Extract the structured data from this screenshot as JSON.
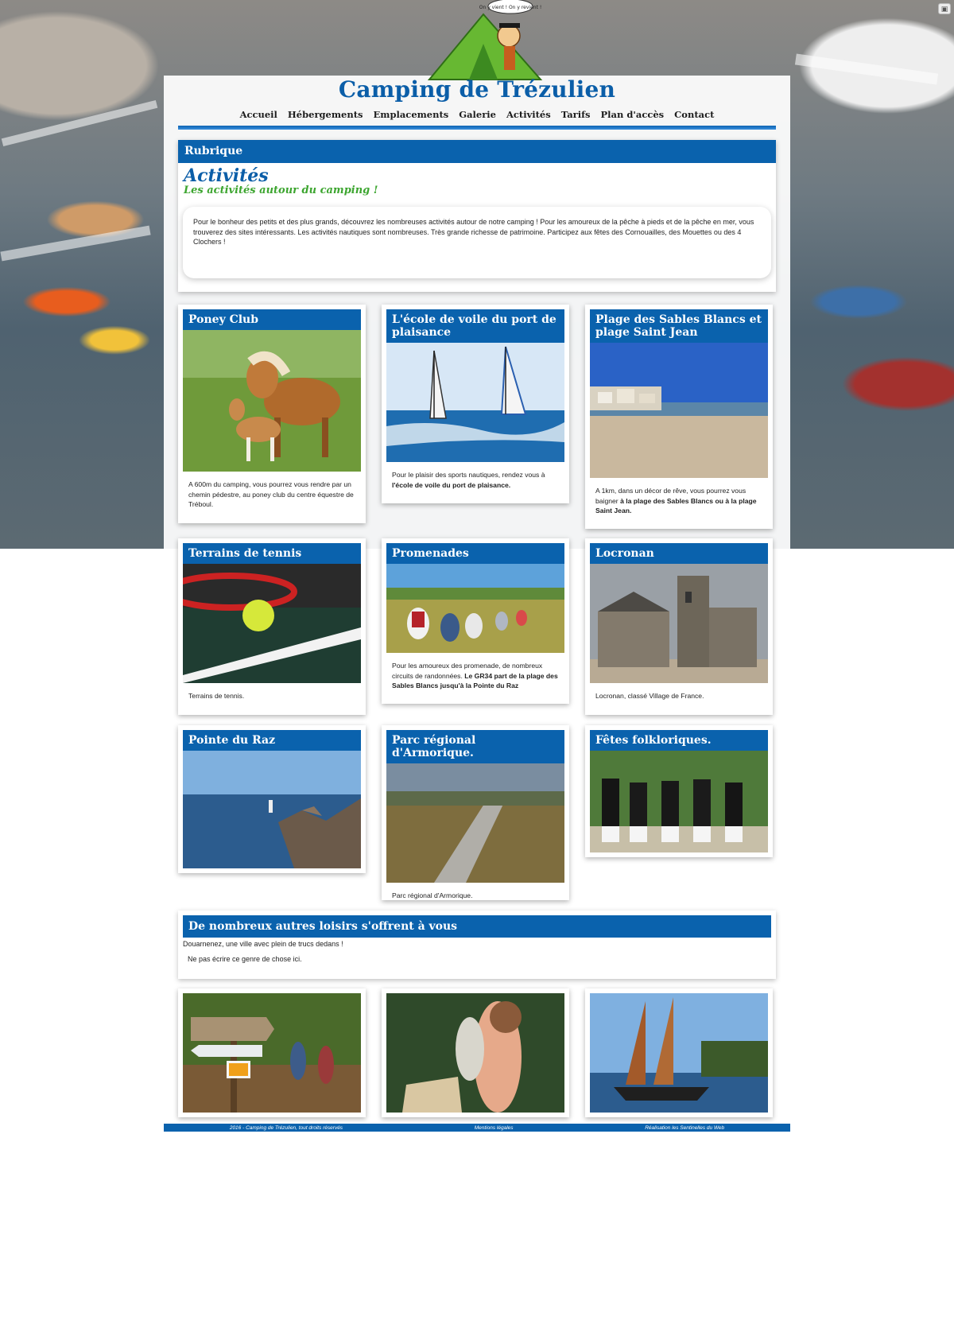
{
  "site": {
    "title": "Camping de Trézulien",
    "logo_bubble": "On y vient ! On y revient !"
  },
  "nav": [
    {
      "label": "Accueil"
    },
    {
      "label": "Hébergements"
    },
    {
      "label": "Emplacements"
    },
    {
      "label": "Galerie"
    },
    {
      "label": "Activités"
    },
    {
      "label": "Tarifs"
    },
    {
      "label": "Plan d'accès"
    },
    {
      "label": "Contact"
    }
  ],
  "rubrique": {
    "label": "Rubrique",
    "title": "Activités",
    "subtitle": "Les activités autour du camping !",
    "intro": "Pour le bonheur des petits et des plus grands, découvrez les nombreuses activités autour de notre camping ! Pour les amoureux de la pêche à pieds et de la pêche en mer, vous trouverez des sites intéressants. Les activités nautiques sont nombreuses. Très grande richesse de patrimoine. Participez aux fêtes des Cornouailles, des Mouettes ou des 4 Clochers !"
  },
  "cards": [
    {
      "title": "Poney Club",
      "text_a": "A 600m du camping, vous pourrez vous rendre par un chemin pédestre, au poney club du centre équestre de Tréboul.",
      "text_b": ""
    },
    {
      "title": "L'école de voile du port de plaisance",
      "text_a": "Pour le plaisir des sports nautiques, rendez vous à ",
      "text_b": "l'école de voile du port de plaisance."
    },
    {
      "title": "Plage des Sables Blancs et plage Saint Jean",
      "text_a": "A 1km, dans un décor de rêve, vous pourrez vous baigner ",
      "text_b": "à la plage des Sables Blancs ou à la plage Saint Jean."
    },
    {
      "title": "Terrains de tennis",
      "text_a": "Terrains de tennis.",
      "text_b": ""
    },
    {
      "title": "Promenades",
      "text_a": "Pour les amoureux des promenade, de nombreux circuits de randonnées. ",
      "text_b": "Le GR34 part de la plage des Sables Blancs jusqu'à la Pointe du Raz"
    },
    {
      "title": "Locronan",
      "text_a": "Locronan, classé Village de France.",
      "text_b": ""
    },
    {
      "title": "Pointe du Raz",
      "text_a": "",
      "text_b": ""
    },
    {
      "title": "Parc régional d'Armorique.",
      "text_a": "Parc régional d'Armorique.",
      "text_b": ""
    },
    {
      "title": "Fêtes folkloriques.",
      "text_a": "",
      "text_b": ""
    }
  ],
  "loisirs": {
    "title": "De nombreux autres loisirs s'offrent à vous",
    "line1": "Douarnenez, une ville avec plein de trucs dedans !",
    "line2": "Ne pas écrire ce genre de chose ici."
  },
  "footer": {
    "copyright": "2016 - Camping de Trézulien, tout droits réservés",
    "legal": "Mentions légales",
    "credit": "Réalisation les Sentinelles du Web"
  },
  "colors": {
    "brand_blue": "#0a62ad",
    "accent_green": "#3ca52f"
  }
}
